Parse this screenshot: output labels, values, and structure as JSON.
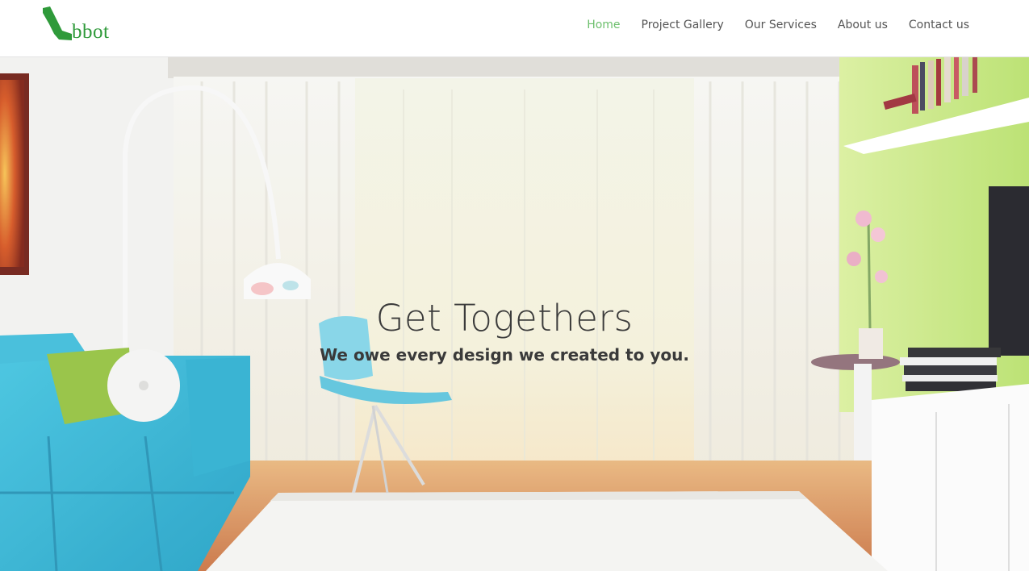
{
  "brand": {
    "logo_text": "bbot",
    "accent": "#2f9a3a"
  },
  "nav": {
    "items": [
      {
        "label": "Home",
        "active": true
      },
      {
        "label": "Project Gallery",
        "active": false
      },
      {
        "label": "Our Services",
        "active": false
      },
      {
        "label": "About us",
        "active": false
      },
      {
        "label": "Contact us",
        "active": false
      }
    ],
    "active_color": "#6cbf6c",
    "default_color": "#555555"
  },
  "hero": {
    "title": "Get Togethers",
    "subtitle": "We owe every design we created to you."
  }
}
